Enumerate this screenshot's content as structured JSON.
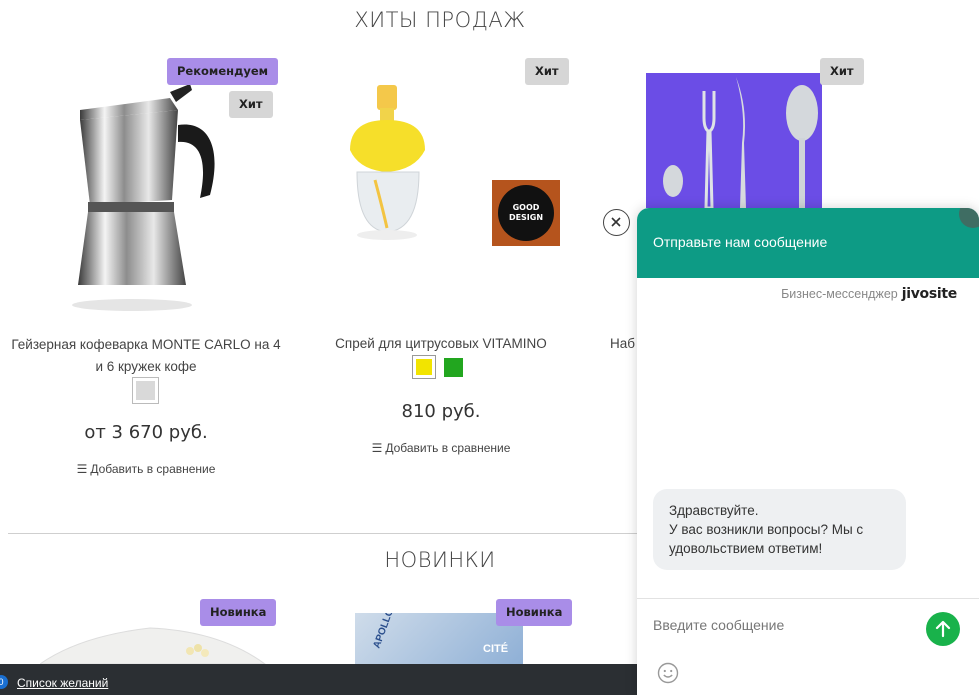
{
  "sections": {
    "hits_title": "ХИТЫ ПРОДАЖ",
    "new_title": "НОВИНКИ"
  },
  "products": [
    {
      "name": "Гейзерная кофеварка MONTE CARLO на 4 и 6 кружек кофе",
      "badges": [
        "Рекомендуем",
        "Хит"
      ],
      "price": "от 3 670 руб.",
      "colors": [
        "#d9d9d9"
      ],
      "compare": "Добавить в сравнение"
    },
    {
      "name": "Спрей для цитрусовых VITAMINO",
      "badges": [
        "Хит"
      ],
      "price": "810 руб.",
      "colors": [
        "#f2e400",
        "#22a61f"
      ],
      "compare": "Добавить в сравнение",
      "award_label": "GOOD DESIGN"
    },
    {
      "name": "Наб",
      "badges": [
        "Хит"
      ]
    }
  ],
  "new_products": [
    {
      "badge": "Новинка"
    },
    {
      "badge": "Новинка",
      "brand": "APOLLO",
      "sub": "CITÉ"
    }
  ],
  "bottom_bar": {
    "wishlist_label": "Список желаний",
    "wishlist_count": "0"
  },
  "chat": {
    "header": "Отправьте нам сообщение",
    "brand_prefix": "Бизнес-мессенджер",
    "brand_name": "jivosite",
    "message": "Здравствуйте.\nУ вас возникли вопросы? Мы с удовольствием ответим!",
    "input_placeholder": "Введите сообщение",
    "accent": "#0d9b85",
    "send_color": "#19b24b"
  },
  "colors": {
    "badge_recommend": "#a98de8",
    "badge_hit": "#d6d6d6",
    "bottom_bar": "#2b2f33"
  },
  "icons": [
    "close-icon",
    "send-arrow-icon",
    "emoji-icon",
    "compare-list-icon"
  ]
}
